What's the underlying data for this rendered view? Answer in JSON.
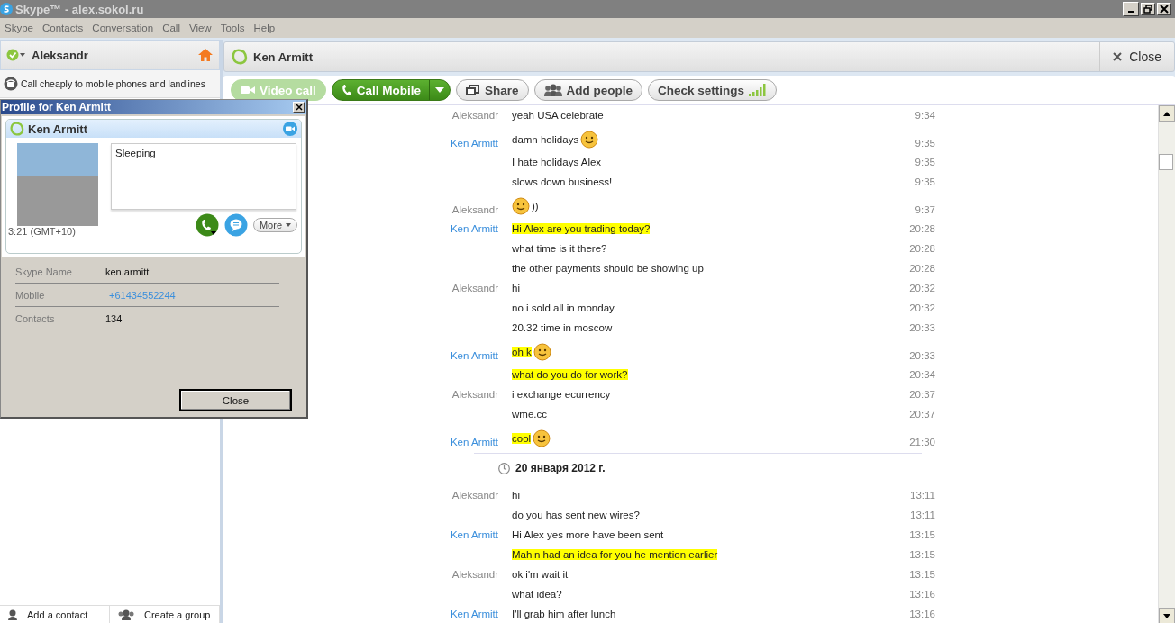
{
  "window": {
    "title": "Skype™ - alex.sokol.ru"
  },
  "menu": [
    "Skype",
    "Contacts",
    "Conversation",
    "Call",
    "View",
    "Tools",
    "Help"
  ],
  "sidebar": {
    "user": "Aleksandr",
    "promo": "Call cheaply to mobile phones and landlines",
    "footer_buttons": [
      {
        "label": "Add a contact",
        "kind": "contact"
      },
      {
        "label": "Create a group",
        "kind": "group"
      }
    ]
  },
  "conversation": {
    "contact": "Ken Armitt",
    "close": "Close",
    "toolbar": [
      {
        "label": "Video call",
        "kind": "video",
        "disabled": true
      },
      {
        "label": "Call Mobile",
        "kind": "call",
        "disabled": false
      },
      {
        "label": "Share",
        "kind": "share",
        "disabled": false
      },
      {
        "label": "Add people",
        "kind": "people",
        "disabled": false
      },
      {
        "label": "Check settings",
        "kind": "settings",
        "disabled": false
      }
    ],
    "messages": [
      {
        "kind": "outgoing",
        "sender": "Aleksandr",
        "text": "yeah USA celebrate",
        "time": "9:34",
        "highlighted": false
      },
      {
        "kind": "incoming",
        "sender": "Ken Armitt",
        "text": "damn holidays",
        "time": "9:35",
        "highlighted": false,
        "emoticon_after": true
      },
      {
        "kind": "incoming",
        "text": "I hate holidays Alex",
        "time": "9:35",
        "highlighted": false
      },
      {
        "kind": "incoming",
        "text": "slows down business!",
        "time": "9:35",
        "highlighted": false
      },
      {
        "kind": "outgoing",
        "sender": "Aleksandr",
        "text": "))",
        "time": "9:37",
        "highlighted": false,
        "emoticon_before": true
      },
      {
        "kind": "incoming",
        "sender": "Ken Armitt",
        "text": "Hi Alex are you trading today?",
        "time": "20:28",
        "highlighted": true
      },
      {
        "kind": "incoming",
        "text": "what time is it there?",
        "time": "20:28",
        "highlighted": false
      },
      {
        "kind": "incoming",
        "text": "the other payments should be showing up",
        "time": "20:28",
        "highlighted": false
      },
      {
        "kind": "outgoing",
        "sender": "Aleksandr",
        "text": "hi",
        "time": "20:32",
        "highlighted": false
      },
      {
        "kind": "outgoing",
        "text": "no i sold all in monday",
        "time": "20:32",
        "highlighted": false
      },
      {
        "kind": "outgoing",
        "text": "20.32 time in moscow",
        "time": "20:33",
        "highlighted": false
      },
      {
        "kind": "incoming",
        "sender": "Ken Armitt",
        "text": "oh k",
        "time": "20:33",
        "highlighted": true,
        "emoticon_after": true
      },
      {
        "kind": "incoming",
        "text": "what do you do for work?",
        "time": "20:34",
        "highlighted": true
      },
      {
        "kind": "outgoing",
        "sender": "Aleksandr",
        "text": "i exchange ecurrency",
        "time": "20:37",
        "highlighted": false
      },
      {
        "kind": "outgoing",
        "text": "wme.cc",
        "time": "20:37",
        "highlighted": false
      },
      {
        "kind": "incoming",
        "sender": "Ken Armitt",
        "text": "cool",
        "time": "21:30",
        "highlighted": true,
        "emoticon_after": true
      },
      {
        "kind": "date",
        "text": "20 января 2012 г."
      },
      {
        "kind": "outgoing",
        "sender": "Aleksandr",
        "text": "hi",
        "time": "13:11",
        "highlighted": false
      },
      {
        "kind": "outgoing",
        "text": "do you has sent new wires?",
        "time": "13:11",
        "highlighted": false
      },
      {
        "kind": "incoming",
        "sender": "Ken Armitt",
        "text": "Hi Alex yes more have been sent",
        "time": "13:15",
        "highlighted": false
      },
      {
        "kind": "incoming",
        "text": "Mahin had an idea for you he mention earlier",
        "time": "13:15",
        "highlighted": true
      },
      {
        "kind": "outgoing",
        "sender": "Aleksandr",
        "text": "ok i'm wait it",
        "time": "13:15",
        "highlighted": false
      },
      {
        "kind": "outgoing",
        "text": "what idea?",
        "time": "13:16",
        "highlighted": false
      },
      {
        "kind": "incoming",
        "sender": "Ken Armitt",
        "text": "I'll grab him after lunch",
        "time": "13:16",
        "highlighted": false
      }
    ]
  },
  "profile_dialog": {
    "title": "Profile for Ken Armitt",
    "name": "Ken Armitt",
    "mood": "Sleeping",
    "local_time": "3:21 (GMT+10)",
    "more": "More",
    "fields": [
      {
        "label": "Skype Name",
        "value": "ken.armitt",
        "kind": "text"
      },
      {
        "label": "Mobile",
        "value": "+61434552244",
        "kind": "link"
      },
      {
        "label": "Contacts",
        "value": "134",
        "kind": "text"
      }
    ],
    "close": "Close"
  }
}
